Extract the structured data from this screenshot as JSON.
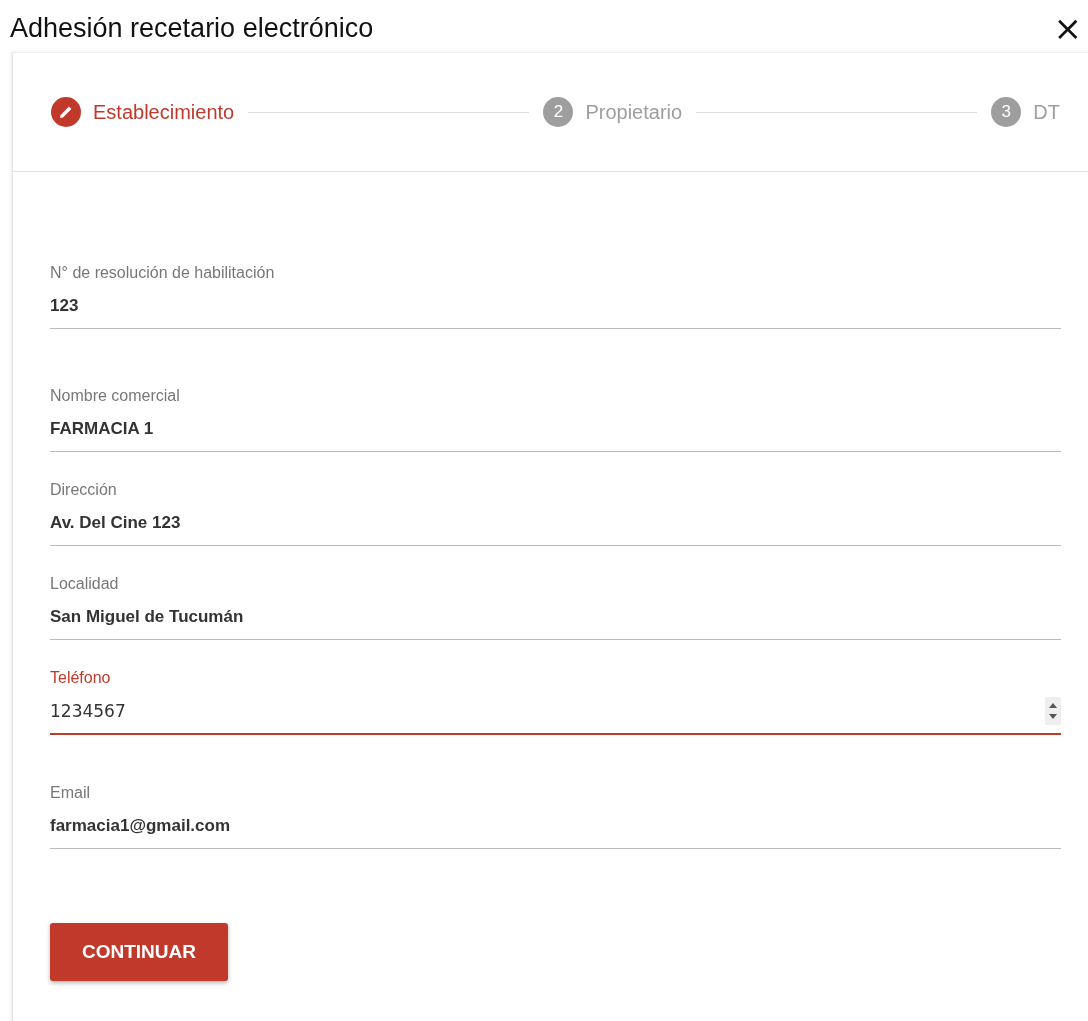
{
  "window": {
    "title": "Adhesión recetario electrónico",
    "close": "×"
  },
  "steps": [
    {
      "label": "Establecimiento",
      "selected": true
    },
    {
      "label": "Propietario",
      "number": "2",
      "selected": false
    },
    {
      "label": "DT",
      "number": "3",
      "selected": false
    }
  ],
  "fields": [
    {
      "label": "N° de resolución de habilitación",
      "value": "123",
      "kind": "text",
      "focused": false
    },
    {
      "label": "Nombre comercial",
      "value": "FARMACIA 1",
      "kind": "text",
      "focused": false
    },
    {
      "label": "Dirección",
      "value": "Av. Del Cine 123",
      "kind": "text",
      "focused": false
    },
    {
      "label": "Localidad",
      "value": "San Miguel de Tucumán",
      "kind": "text",
      "focused": false
    },
    {
      "label": "Teléfono",
      "value": "1234567",
      "kind": "number",
      "focused": true
    },
    {
      "label": "Email",
      "value": "farmacia1@gmail.com",
      "kind": "text",
      "focused": false
    }
  ],
  "button": "CONTINUAR"
}
